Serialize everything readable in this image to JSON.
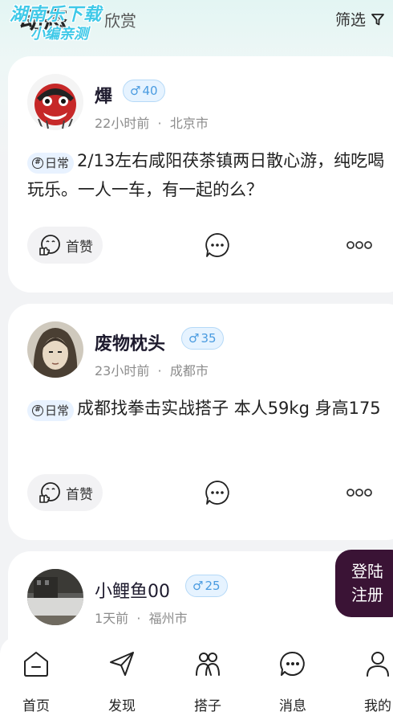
{
  "watermark": {
    "line1": "湖南乐下载",
    "line2": "小编亲测"
  },
  "top": {
    "tab_active": "动态",
    "tab_inactive": "欣赏",
    "filter_label": "筛选"
  },
  "posts": [
    {
      "name": "熚",
      "gender": "♂",
      "age": "40",
      "time": "22小时前",
      "location": "北京市",
      "tag": "日常",
      "text": "2/13左右咸阳茯茶镇两日散心游，纯吃喝玩乐。一人一车，有一起的么？",
      "like_label": "首赞"
    },
    {
      "name": "废物枕头",
      "gender": "♂",
      "age": "35",
      "time": "23小时前",
      "location": "成都市",
      "tag": "日常",
      "text": "成都找拳击实战搭子 本人59kg 身高175",
      "like_label": "首赞"
    },
    {
      "name": "小鲤鱼00",
      "gender": "♂",
      "age": "25",
      "time": "1天前",
      "location": "福州市"
    }
  ],
  "login": {
    "line1": "登陆",
    "line2": "注册"
  },
  "nav": [
    {
      "label": "首页",
      "icon": "home-icon"
    },
    {
      "label": "发现",
      "icon": "paper-plane-icon"
    },
    {
      "label": "搭子",
      "icon": "people-icon"
    },
    {
      "label": "消息",
      "icon": "chat-icon"
    },
    {
      "label": "我的",
      "icon": "user-icon"
    }
  ],
  "colors": {
    "accent": "#3a1335",
    "badge_blue": "#4a9be0",
    "tag_bg": "#e8f2ff"
  }
}
